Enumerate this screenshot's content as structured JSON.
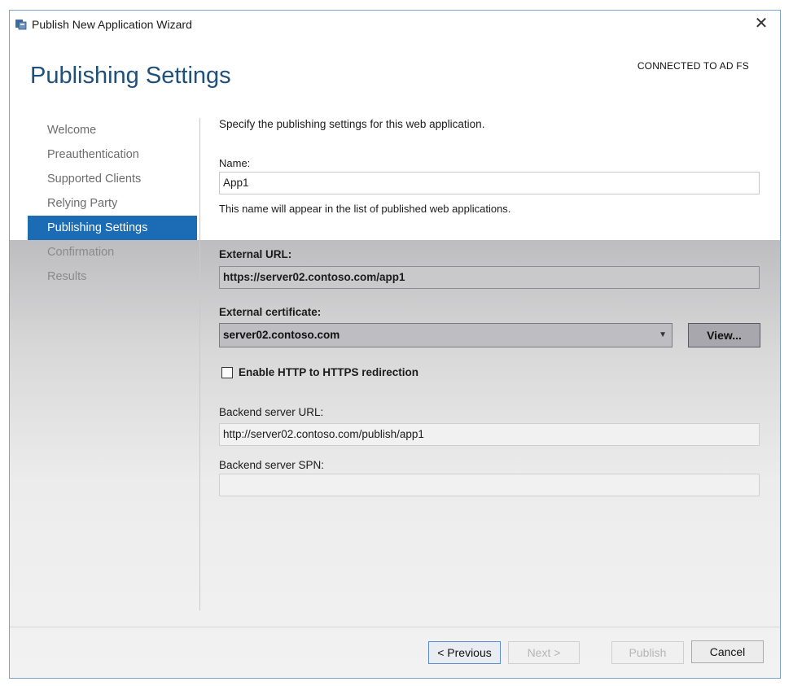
{
  "window": {
    "title": "Publish New Application Wizard",
    "close_glyph": "✕"
  },
  "header": {
    "heading": "Publishing Settings",
    "connection_status": "CONNECTED TO AD FS"
  },
  "nav": {
    "items": [
      {
        "label": "Welcome"
      },
      {
        "label": "Preauthentication"
      },
      {
        "label": "Supported Clients"
      },
      {
        "label": "Relying Party"
      },
      {
        "label": "Publishing Settings"
      },
      {
        "label": "Confirmation"
      },
      {
        "label": "Results"
      }
    ],
    "active_index": 4
  },
  "form": {
    "intro": "Specify the publishing settings for this web application.",
    "name_label": "Name:",
    "name_value": "App1",
    "name_hint": "This name will appear in the list of published web applications.",
    "external_url_label": "External URL:",
    "external_url_value": "https://server02.contoso.com/app1",
    "external_certificate_label": "External certificate:",
    "external_certificate_value": "server02.contoso.com",
    "view_button": "View...",
    "https_redirect_label": "Enable HTTP to HTTPS redirection",
    "https_redirect_checked": false,
    "backend_url_label": "Backend server URL:",
    "backend_url_value": "http://server02.contoso.com/publish/app1",
    "backend_spn_label": "Backend server SPN:",
    "backend_spn_value": ""
  },
  "footer": {
    "previous": "< Previous",
    "next": "Next >",
    "publish": "Publish",
    "cancel": "Cancel"
  },
  "colors": {
    "accent": "#1c6bb5",
    "heading": "#1f4f7a"
  }
}
